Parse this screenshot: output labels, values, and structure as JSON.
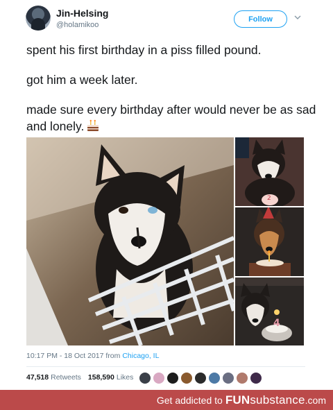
{
  "tweet": {
    "display_name": "Jin-Helsing",
    "handle": "@holamikoo",
    "follow_label": "Follow",
    "lines": [
      "spent his first birthday in a piss filled pound.",
      "got him a week later.",
      "made sure every birthday after would never be as sad and lonely."
    ],
    "timestamp": "10:17 PM - 18 Oct 2017 from ",
    "location": "Chicago, IL",
    "retweets_count": "47,518",
    "retweets_label": "Retweets",
    "likes_count": "158,590",
    "likes_label": "Likes",
    "icons": [
      "avatar",
      "chevron-down-icon",
      "birthday-cake-icon"
    ]
  },
  "footer": {
    "prefix": "Get addicted to",
    "brand_bold": "FUN",
    "brand_light": "substance",
    "domain": ".com",
    "background": "#bb4a4a"
  },
  "colors": {
    "accent": "#1da1f2",
    "text": "#14171a",
    "muted": "#657786"
  }
}
